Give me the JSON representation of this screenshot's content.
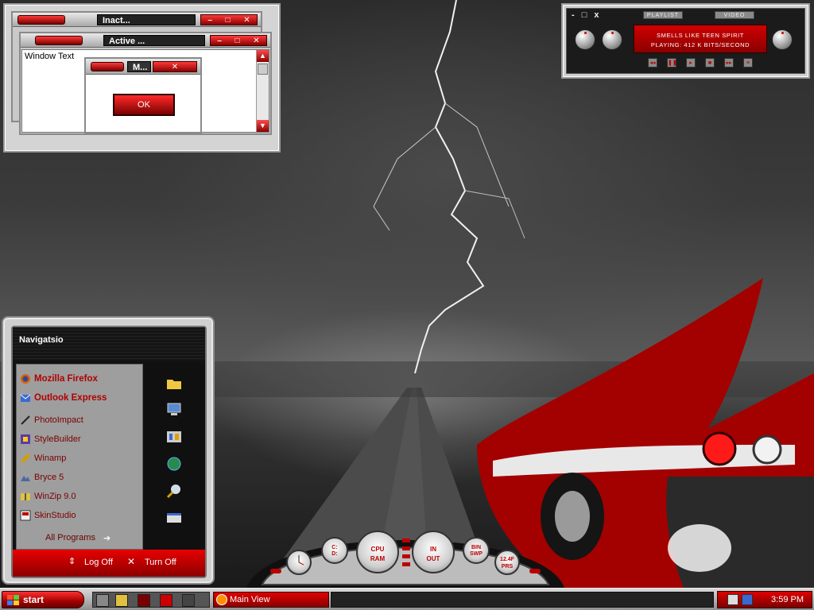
{
  "theme_preview": {
    "inactive_title": "Inact...",
    "active_title": "Active ...",
    "message_title": "M...",
    "window_text": "Window Text",
    "ok_button": "OK"
  },
  "player": {
    "window_controls": "- □ x",
    "tabs": [
      "PLAYLIST",
      "VIDEO"
    ],
    "track_title": "SMELLS LIKE TEEN SPIRIT",
    "track_status": "PLAYING: 412 K BITS/SECOND",
    "controls": [
      "prev-icon",
      "pause-icon",
      "play-icon",
      "stop-icon",
      "next-icon",
      "eject-icon"
    ]
  },
  "start_menu": {
    "title": "Navigatsio",
    "pinned": [
      {
        "label": "Mozilla Firefox",
        "icon": "firefox-icon"
      },
      {
        "label": "Outlook Express",
        "icon": "outlook-icon"
      }
    ],
    "programs": [
      {
        "label": "PhotoImpact",
        "icon": "photoimpact-icon"
      },
      {
        "label": "StyleBuilder",
        "icon": "stylebuilder-icon"
      },
      {
        "label": "Winamp",
        "icon": "winamp-icon"
      },
      {
        "label": "Bryce 5",
        "icon": "bryce-icon"
      },
      {
        "label": "WinZip 9.0",
        "icon": "winzip-icon"
      },
      {
        "label": "SkinStudio",
        "icon": "skinstudio-icon"
      }
    ],
    "all_programs": "All Programs",
    "places": [
      "folder-icon",
      "computer-icon",
      "control-panel-icon",
      "network-icon",
      "search-icon",
      "run-icon"
    ],
    "log_off": "Log Off",
    "turn_off": "Turn Off"
  },
  "dashboard": {
    "gauges": [
      "C:\nD:",
      "CPU\nRAM",
      "IN\nOUT",
      "BIN\nSWP",
      "12.4F\nPRS"
    ]
  },
  "taskbar": {
    "start_label": "start",
    "active_task": "Main View",
    "clock": "3:59 PM"
  },
  "colors": {
    "accent_red": "#cc0000",
    "dark_red": "#7a0000"
  }
}
